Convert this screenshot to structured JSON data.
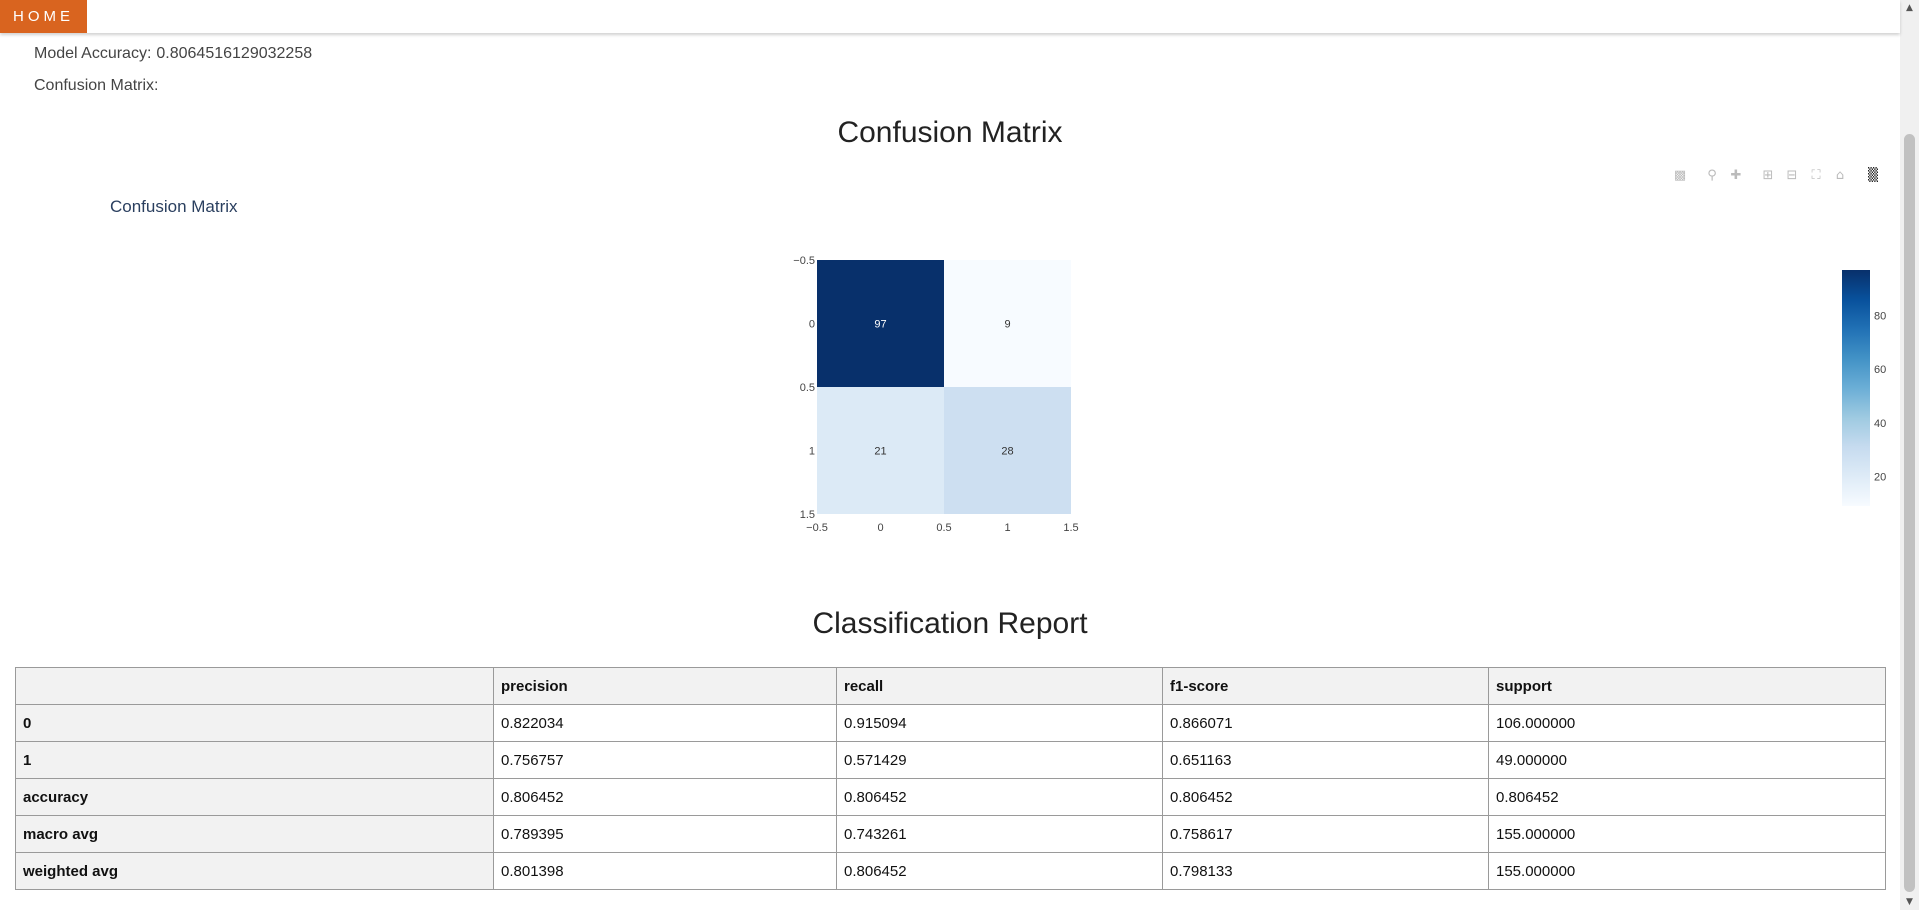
{
  "nav": {
    "home_label": "HOME"
  },
  "accuracy": {
    "label": "Model Accuracy:",
    "value": "0.8064516129032258"
  },
  "confusion_label": "Confusion Matrix:",
  "section_titles": {
    "confusion": "Confusion Matrix",
    "report": "Classification Report"
  },
  "plot": {
    "title": "Confusion Matrix",
    "modebar": [
      "camera-icon",
      "zoom-icon",
      "pan-icon",
      "zoom-in-icon",
      "zoom-out-icon",
      "autoscale-icon",
      "reset-axes-icon",
      "plotly-logo-icon"
    ]
  },
  "chart_data": {
    "type": "heatmap",
    "title": "Confusion Matrix",
    "x": [
      0,
      1
    ],
    "y": [
      0,
      1
    ],
    "z": [
      [
        97,
        9
      ],
      [
        21,
        28
      ]
    ],
    "xlim": [
      -0.5,
      1.5
    ],
    "ylim": [
      1.5,
      -0.5
    ],
    "x_ticks": [
      "−0.5",
      "0",
      "0.5",
      "1",
      "1.5"
    ],
    "y_ticks": [
      "−0.5",
      "0",
      "0.5",
      "1",
      "1.5"
    ],
    "colorscale": "Blues",
    "colorbar": {
      "ticks": [
        20,
        40,
        60,
        80
      ],
      "range": [
        9,
        97
      ]
    }
  },
  "report": {
    "columns": [
      "",
      "precision",
      "recall",
      "f1-score",
      "support"
    ],
    "rows": [
      {
        "label": "0",
        "values": [
          "0.822034",
          "0.915094",
          "0.866071",
          "106.000000"
        ]
      },
      {
        "label": "1",
        "values": [
          "0.756757",
          "0.571429",
          "0.651163",
          "49.000000"
        ]
      },
      {
        "label": "accuracy",
        "values": [
          "0.806452",
          "0.806452",
          "0.806452",
          "0.806452"
        ]
      },
      {
        "label": "macro avg",
        "values": [
          "0.789395",
          "0.743261",
          "0.758617",
          "155.000000"
        ]
      },
      {
        "label": "weighted avg",
        "values": [
          "0.801398",
          "0.806452",
          "0.798133",
          "155.000000"
        ]
      }
    ]
  }
}
